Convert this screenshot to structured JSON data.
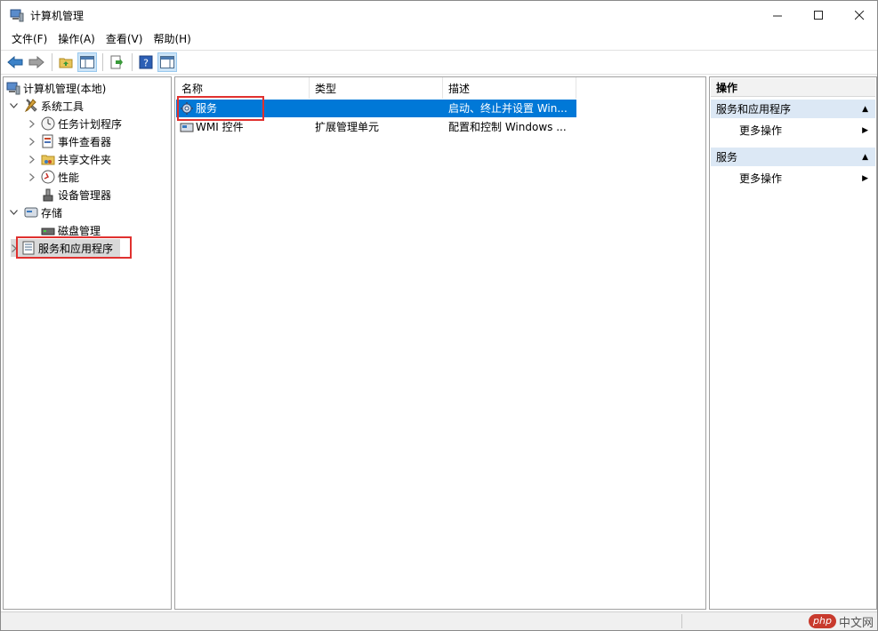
{
  "window": {
    "title": "计算机管理",
    "controls": {
      "minimize": "—",
      "maximize": "☐",
      "close": "✕"
    }
  },
  "menu": [
    {
      "label": "文件(F)"
    },
    {
      "label": "操作(A)"
    },
    {
      "label": "查看(V)"
    },
    {
      "label": "帮助(H)"
    }
  ],
  "toolbar": {
    "icons": [
      "back-arrow-icon",
      "forward-arrow-icon",
      "up-folder-icon",
      "show-hide-tree-icon",
      "export-list-icon",
      "help-icon",
      "show-hide-action-pane-icon"
    ]
  },
  "tree": {
    "root": "计算机管理(本地)",
    "system_tools": "系统工具",
    "task_scheduler": "任务计划程序",
    "event_viewer": "事件查看器",
    "shared_folders": "共享文件夹",
    "performance": "性能",
    "device_manager": "设备管理器",
    "storage": "存储",
    "disk_management": "磁盘管理",
    "services_apps": "服务和应用程序"
  },
  "list": {
    "columns": [
      "名称",
      "类型",
      "描述"
    ],
    "rows": [
      {
        "name": "服务",
        "type": "",
        "desc": "启动、终止并设置 Win..."
      },
      {
        "name": "WMI 控件",
        "type": "扩展管理单元",
        "desc": "配置和控制 Windows ..."
      }
    ],
    "selected_index": 0
  },
  "actions": {
    "header": "操作",
    "sections": [
      {
        "title": "服务和应用程序",
        "items": [
          "更多操作"
        ]
      },
      {
        "title": "服务",
        "items": [
          "更多操作"
        ]
      }
    ]
  },
  "watermark": {
    "brand": "php",
    "site": "中文网"
  },
  "colors": {
    "selection": "#0078d7",
    "highlight_box": "#e0312f",
    "section_header": "#dce8f5"
  }
}
